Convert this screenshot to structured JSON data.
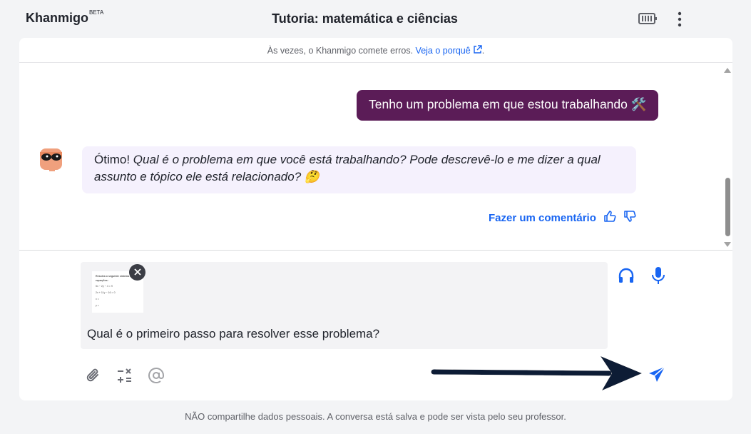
{
  "header": {
    "brand": "Khanmigo",
    "brand_badge": "BETA",
    "title": "Tutoria: matemática e ciências",
    "icons": [
      "keyboard-icon",
      "more-vertical-icon"
    ]
  },
  "notice": {
    "text": "Às vezes, o Khanmigo comete erros.",
    "link": "Veja o porquê",
    "suffix": "."
  },
  "chat": {
    "user_message": "Tenho um problema em que estou trabalhando 🛠️",
    "bot_prefix": "Ótimo! ",
    "bot_message": "Qual é o problema em que você está trabalhando? Pode descrevê-lo e me dizer a qual assunto e tópico ele está relacionado? 🤔",
    "feedback_label": "Fazer um comentário"
  },
  "composer": {
    "attachment_lines": [
      "Resolva o seguinte sistema de equações:",
      "5x − 2y − 4 = 9",
      "2x + 11y − 16 = 0",
      "x =",
      "y ="
    ],
    "text": "Qual é o primeiro passo para resolver esse problema?"
  },
  "footer": {
    "text": "NÃO compartilhe dados pessoais. A conversa está salva e pode ser vista pelo seu professor."
  },
  "colors": {
    "accent": "#1865f2",
    "user_bubble": "#5b1c57",
    "bot_bubble": "#f5f1fd",
    "avatar": "#f0a07d",
    "annotation_arrow": "#0d1b35"
  }
}
